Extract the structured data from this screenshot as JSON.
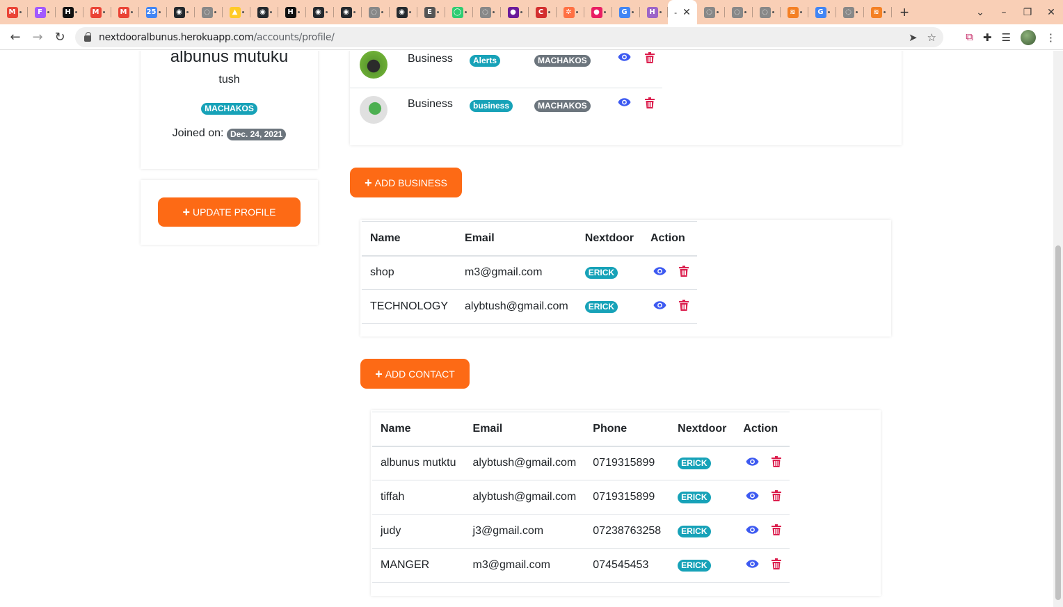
{
  "browser": {
    "tabs": [
      {
        "icon": "gmail-icon",
        "color": "#ea4335",
        "glyph": "M"
      },
      {
        "icon": "figma-icon",
        "color": "#a259ff",
        "glyph": "F"
      },
      {
        "icon": "hackernoon-icon",
        "color": "#111111",
        "glyph": "H"
      },
      {
        "icon": "gmail-icon",
        "color": "#ea4335",
        "glyph": "M"
      },
      {
        "icon": "gmail-icon",
        "color": "#ea4335",
        "glyph": "M"
      },
      {
        "icon": "calendar-icon",
        "color": "#4285f4",
        "glyph": "25"
      },
      {
        "icon": "github-icon",
        "color": "#24292e",
        "glyph": "◉"
      },
      {
        "icon": "globe-icon",
        "color": "#888888",
        "glyph": "◌"
      },
      {
        "icon": "firebase-icon",
        "color": "#ffca28",
        "glyph": "▲"
      },
      {
        "icon": "github-icon",
        "color": "#24292e",
        "glyph": "◉"
      },
      {
        "icon": "hackernoon-icon",
        "color": "#111111",
        "glyph": "H"
      },
      {
        "icon": "github-icon",
        "color": "#24292e",
        "glyph": "◉"
      },
      {
        "icon": "github-icon",
        "color": "#24292e",
        "glyph": "◉"
      },
      {
        "icon": "globe-icon",
        "color": "#888888",
        "glyph": "◌"
      },
      {
        "icon": "github-icon",
        "color": "#24292e",
        "glyph": "◉"
      },
      {
        "icon": "audio-icon",
        "color": "#555555",
        "glyph": "E"
      },
      {
        "icon": "app-icon",
        "color": "#2ecc71",
        "glyph": "◯"
      },
      {
        "icon": "globe-icon",
        "color": "#888888",
        "glyph": "◌"
      },
      {
        "icon": "circle-icon",
        "color": "#6a1b9a",
        "glyph": "●"
      },
      {
        "icon": "c-icon",
        "color": "#d32f2f",
        "glyph": "C"
      },
      {
        "icon": "pinwheel-icon",
        "color": "#ff7043",
        "glyph": "✲"
      },
      {
        "icon": "dot-icon",
        "color": "#e91e63",
        "glyph": "●"
      },
      {
        "icon": "google-icon",
        "color": "#4285f4",
        "glyph": "G"
      },
      {
        "icon": "h-icon",
        "color": "#9c64c8",
        "glyph": "H"
      }
    ],
    "active_tab_glyph": "-",
    "active_tab_close": "✕",
    "tabs_after": [
      {
        "icon": "globe-icon",
        "color": "#888888",
        "glyph": "◌"
      },
      {
        "icon": "globe-icon",
        "color": "#888888",
        "glyph": "◌"
      },
      {
        "icon": "globe-icon",
        "color": "#888888",
        "glyph": "◌"
      },
      {
        "icon": "stackoverflow-icon",
        "color": "#f48024",
        "glyph": "≋"
      },
      {
        "icon": "google-icon",
        "color": "#4285f4",
        "glyph": "G"
      },
      {
        "icon": "globe-icon",
        "color": "#888888",
        "glyph": "◌"
      },
      {
        "icon": "stackoverflow-icon",
        "color": "#f48024",
        "glyph": "≋"
      }
    ],
    "url_host": "nextdooralbunus.herokuapp.com",
    "url_path": "/accounts/profile/"
  },
  "profile": {
    "name": "albunus mutuku",
    "username": "tush",
    "location": "MACHAKOS",
    "joined_label": "Joined on:",
    "joined_date": "Dec. 24, 2021",
    "update_button": "UPDATE PROFILE"
  },
  "posts": [
    {
      "name": "Business",
      "category": "Alerts",
      "location": "MACHAKOS",
      "thumb": "cow-photo"
    },
    {
      "name": "Business",
      "category": "business",
      "location": "MACHAKOS",
      "thumb": "leaf-photo"
    }
  ],
  "add_business_button": "ADD BUSINESS",
  "business_table": {
    "headers": [
      "Name",
      "Email",
      "Nextdoor",
      "Action"
    ],
    "rows": [
      {
        "name": "shop",
        "email": "m3@gmail.com",
        "nextdoor": "ERICK"
      },
      {
        "name": "TECHNOLOGY",
        "email": "alybtush@gmail.com",
        "nextdoor": "ERICK"
      }
    ]
  },
  "add_contact_button": "ADD CONTACT",
  "contact_table": {
    "headers": [
      "Name",
      "Email",
      "Phone",
      "Nextdoor",
      "Action"
    ],
    "rows": [
      {
        "name": "albunus mutktu",
        "email": "alybtush@gmail.com",
        "phone": "0719315899",
        "nextdoor": "ERICK"
      },
      {
        "name": "tiffah",
        "email": "alybtush@gmail.com",
        "phone": "0719315899",
        "nextdoor": "ERICK"
      },
      {
        "name": "judy",
        "email": "j3@gmail.com",
        "phone": "07238763258",
        "nextdoor": "ERICK"
      },
      {
        "name": "MANGER",
        "email": "m3@gmail.com",
        "phone": "074545453",
        "nextdoor": "ERICK"
      }
    ]
  },
  "colors": {
    "accent": "#fd6a15",
    "badge_info": "#17a2b8",
    "badge_dark": "#6c757d",
    "view_icon": "#3d5af1",
    "delete_icon": "#dc1f4e"
  }
}
